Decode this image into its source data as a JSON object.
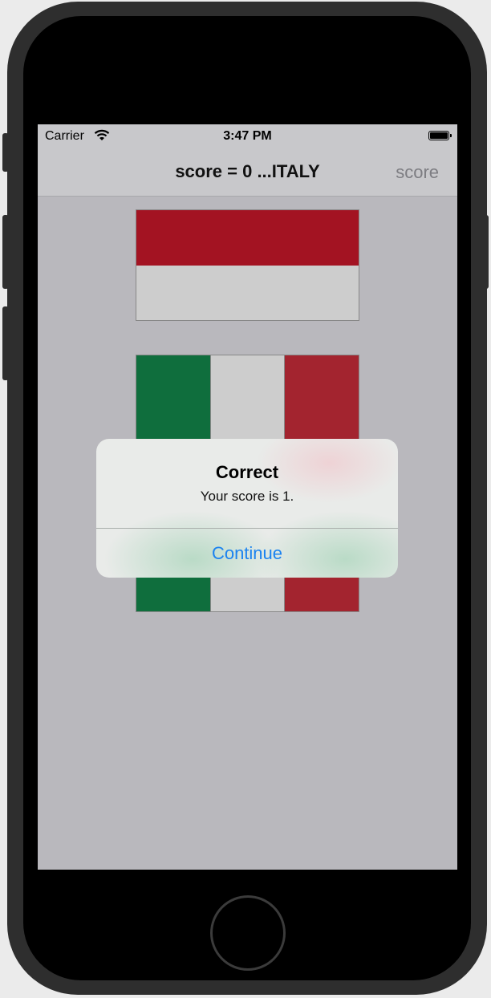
{
  "status_bar": {
    "carrier": "Carrier",
    "time": "3:47 PM"
  },
  "nav_bar": {
    "title": "score = 0 ...ITALY",
    "right_button": "score"
  },
  "flags": [
    "monaco-flag",
    "italy-flag"
  ],
  "alert": {
    "title": "Correct",
    "message": "Your score is 1.",
    "button": "Continue"
  },
  "colors": {
    "accent": "#1a82f0",
    "flag_red": "#a31322",
    "flag_green": "#0f6e3d",
    "flag_white": "#cdcdcd"
  }
}
